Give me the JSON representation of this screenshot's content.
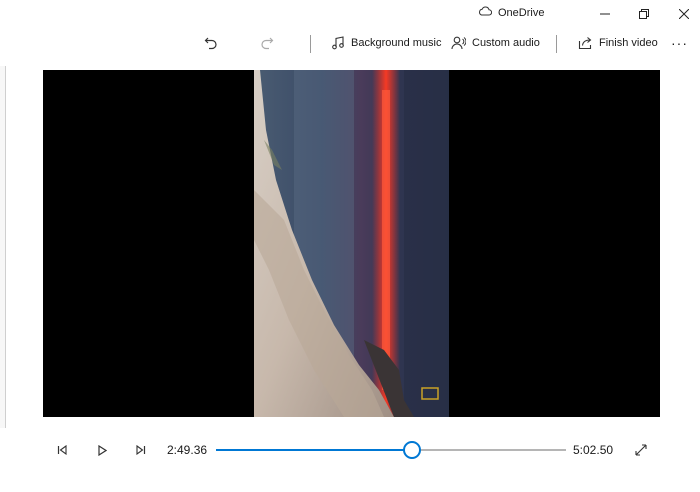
{
  "titlebar": {
    "onedrive_label": "OneDrive",
    "icons": [
      "cloud-icon",
      "minimize-icon",
      "restore-icon",
      "close-icon"
    ]
  },
  "toolbar": {
    "undo_icon": "undo-icon",
    "redo_icon": "redo-icon",
    "background_music_label": "Background music",
    "custom_audio_label": "Custom audio",
    "finish_video_label": "Finish video",
    "more_label": "···"
  },
  "player": {
    "current_time": "2:49.36",
    "total_time": "5:02.50",
    "progress": 0.5607,
    "accent_color": "#0078d4",
    "selection_box_color": "#c9a227"
  }
}
